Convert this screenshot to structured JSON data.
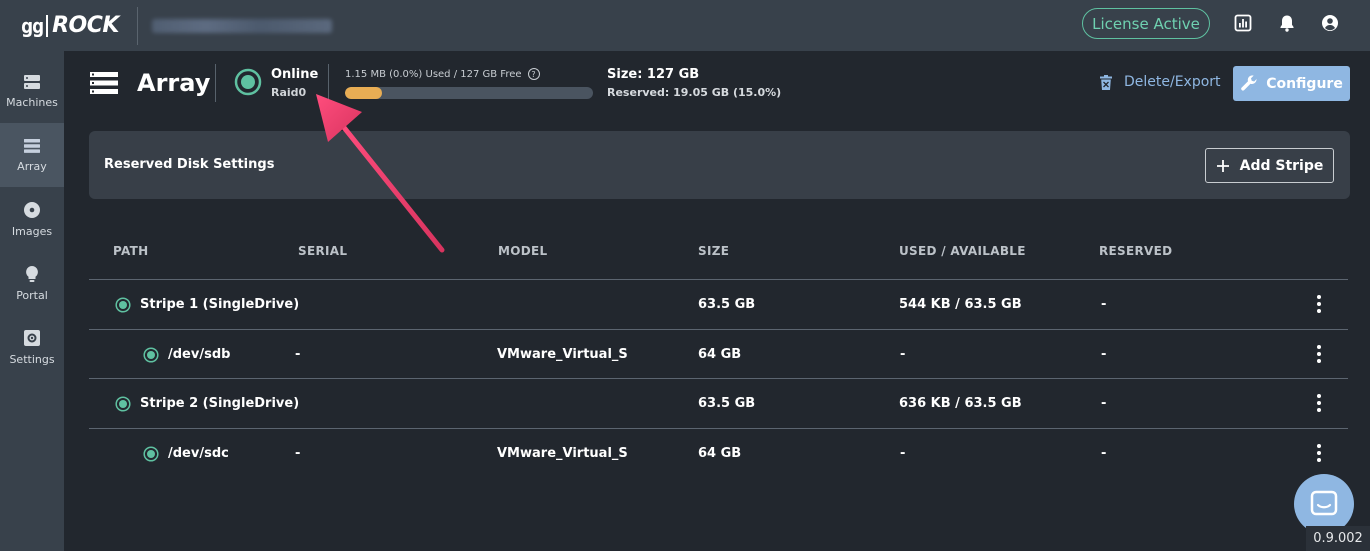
{
  "app": {
    "logo_gg": "gg",
    "logo_rock": "ROCK",
    "license_label": "License Active",
    "version": "0.9.002"
  },
  "sidebar": {
    "items": [
      {
        "label": "Machines",
        "icon": "server-icon"
      },
      {
        "label": "Array",
        "icon": "array-icon"
      },
      {
        "label": "Images",
        "icon": "disc-icon"
      },
      {
        "label": "Portal",
        "icon": "lightbulb-icon"
      },
      {
        "label": "Settings",
        "icon": "settings-icon"
      }
    ],
    "active": "Array"
  },
  "header": {
    "title": "Array",
    "status": "Online",
    "raid": "Raid0",
    "usage_text": "1.15 MB (0.0%) Used / 127 GB Free",
    "usage_percent": 15,
    "size": "Size: 127 GB",
    "reserved": "Reserved: 19.05 GB (15.0%)",
    "delete_label": "Delete/Export",
    "configure_label": "Configure"
  },
  "reserved_panel": {
    "label": "Reserved Disk Settings",
    "add_label": "Add Stripe"
  },
  "table": {
    "columns": [
      "PATH",
      "SERIAL",
      "MODEL",
      "SIZE",
      "USED / AVAILABLE",
      "RESERVED"
    ],
    "rows": [
      {
        "path": "Stripe 1 (SingleDrive)",
        "serial": "",
        "model": "",
        "size": "63.5 GB",
        "used": "544 KB / 63.5 GB",
        "reserved": "-"
      },
      {
        "path": "/dev/sdb",
        "serial": "-",
        "model": "VMware_Virtual_S",
        "size": "64 GB",
        "used": "-",
        "reserved": "-"
      },
      {
        "path": "Stripe 2 (SingleDrive)",
        "serial": "",
        "model": "",
        "size": "63.5 GB",
        "used": "636 KB / 63.5 GB",
        "reserved": "-"
      },
      {
        "path": "/dev/sdc",
        "serial": "-",
        "model": "VMware_Virtual_S",
        "size": "64 GB",
        "used": "-",
        "reserved": "-"
      }
    ]
  },
  "colors": {
    "accent_green": "#5fc1a1",
    "accent_blue": "#8fb7e2",
    "usage_fill": "#e8ad54",
    "arrow": "#e8426e"
  }
}
